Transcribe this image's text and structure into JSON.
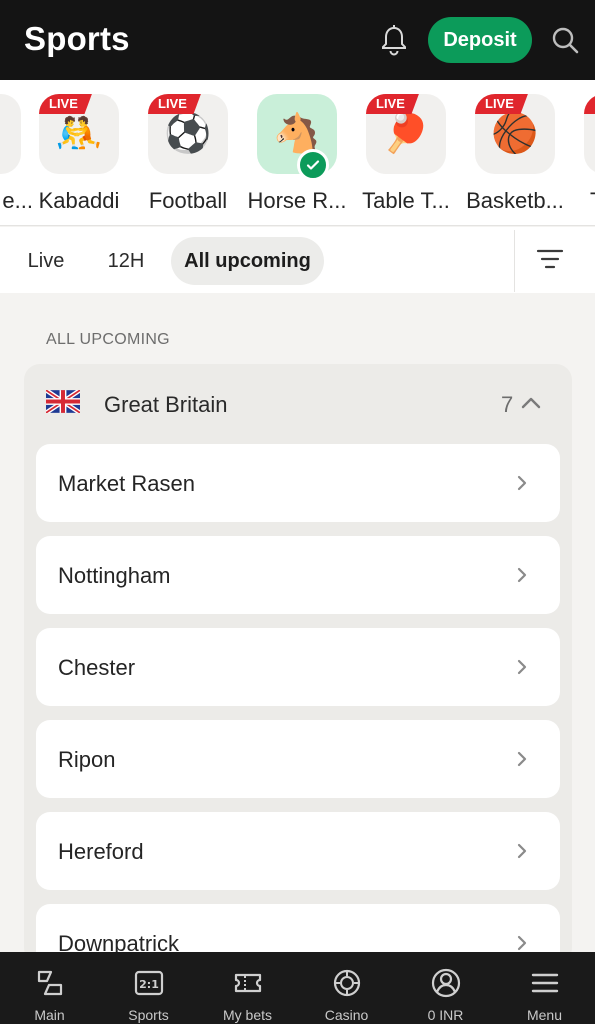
{
  "header": {
    "title": "Sports",
    "deposit_label": "Deposit",
    "icons": [
      "bell-icon",
      "search-icon"
    ]
  },
  "sports": [
    {
      "label": "e...",
      "live": false,
      "emoji": ""
    },
    {
      "label": "Kabaddi",
      "live": true,
      "live_label": "LIVE",
      "emoji": "🤼"
    },
    {
      "label": "Football",
      "live": true,
      "live_label": "LIVE",
      "emoji": "⚽"
    },
    {
      "label": "Horse R...",
      "live": false,
      "selected": true,
      "emoji": "🐴"
    },
    {
      "label": "Table T...",
      "live": true,
      "live_label": "LIVE",
      "emoji": "🏓"
    },
    {
      "label": "Basketb...",
      "live": true,
      "live_label": "LIVE",
      "emoji": "🏀"
    },
    {
      "label": "T",
      "live": false,
      "emoji": ""
    }
  ],
  "tabs": [
    {
      "label": "Live",
      "active": false
    },
    {
      "label": "12H",
      "active": false
    },
    {
      "label": "All upcoming",
      "active": true
    }
  ],
  "section_label": "ALL UPCOMING",
  "group": {
    "country": "Great Britain",
    "count": "7",
    "items": [
      "Market Rasen",
      "Nottingham",
      "Chester",
      "Ripon",
      "Hereford",
      "Downpatrick"
    ]
  },
  "bottom_nav": [
    {
      "label": "Main",
      "icon": "main-icon"
    },
    {
      "label": "Sports",
      "icon": "scoreboard-icon"
    },
    {
      "label": "My bets",
      "icon": "ticket-icon"
    },
    {
      "label": "Casino",
      "icon": "casino-chip-icon"
    },
    {
      "label": "0 INR",
      "icon": "account-icon"
    },
    {
      "label": "Menu",
      "icon": "hamburger-icon"
    }
  ],
  "colors": {
    "brand_green": "#0c9b5a",
    "live_red": "#e0262d",
    "header_bg": "#141414",
    "selected_tile": "#c9efd9"
  }
}
